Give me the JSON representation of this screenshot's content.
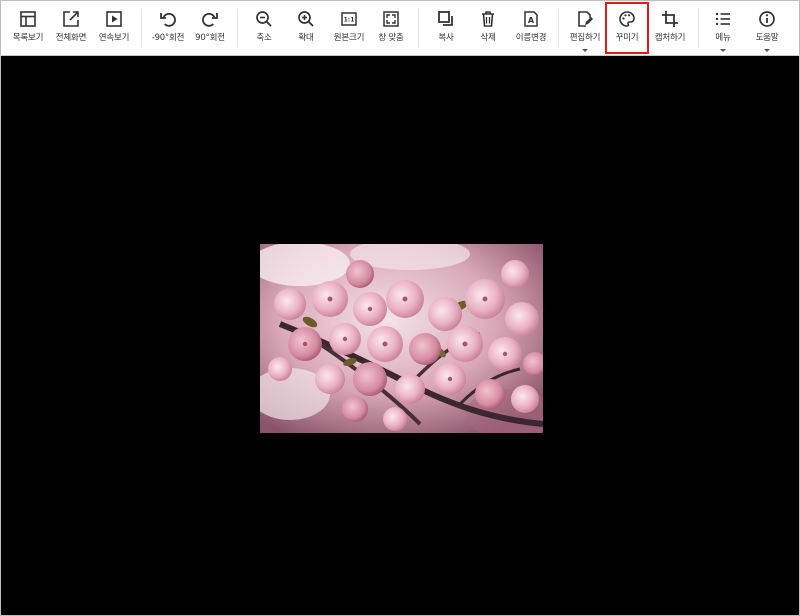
{
  "toolbar": {
    "items": [
      {
        "id": "list",
        "label": "목록보기",
        "icon": "list-view-icon"
      },
      {
        "id": "fullscreen",
        "label": "전체화면",
        "icon": "fullscreen-icon"
      },
      {
        "id": "slideshow",
        "label": "연속보기",
        "icon": "slideshow-icon"
      },
      {
        "id": "rotate-left",
        "label": "-90°회전",
        "icon": "rotate-left-icon"
      },
      {
        "id": "rotate-right",
        "label": "90°회전",
        "icon": "rotate-right-icon"
      },
      {
        "id": "zoom-out",
        "label": "축소",
        "icon": "zoom-out-icon"
      },
      {
        "id": "zoom-in",
        "label": "확대",
        "icon": "zoom-in-icon"
      },
      {
        "id": "original",
        "label": "원본크기",
        "icon": "original-size-icon",
        "icon_text": "1:1"
      },
      {
        "id": "fit",
        "label": "창 맞춤",
        "icon": "fit-window-icon"
      },
      {
        "id": "copy",
        "label": "복사",
        "icon": "copy-icon"
      },
      {
        "id": "delete",
        "label": "삭제",
        "icon": "trash-icon"
      },
      {
        "id": "rename",
        "label": "이름변경",
        "icon": "rename-icon"
      },
      {
        "id": "edit",
        "label": "편집하기",
        "icon": "edit-icon",
        "dropdown": true
      },
      {
        "id": "decorate",
        "label": "꾸미기",
        "icon": "palette-icon",
        "selected": true
      },
      {
        "id": "capture",
        "label": "캡처하기",
        "icon": "crop-icon"
      },
      {
        "id": "menu",
        "label": "메뉴",
        "icon": "menu-icon",
        "dropdown": true
      },
      {
        "id": "help",
        "label": "도움말",
        "icon": "info-icon",
        "dropdown": true
      }
    ]
  },
  "viewer": {
    "background": "#000000",
    "image": {
      "subject": "pink-cherry-blossoms-photo"
    }
  },
  "colors": {
    "selected_outline": "#e21b1b",
    "toolbar_bg": "#ffffff",
    "icon": "#333333"
  }
}
